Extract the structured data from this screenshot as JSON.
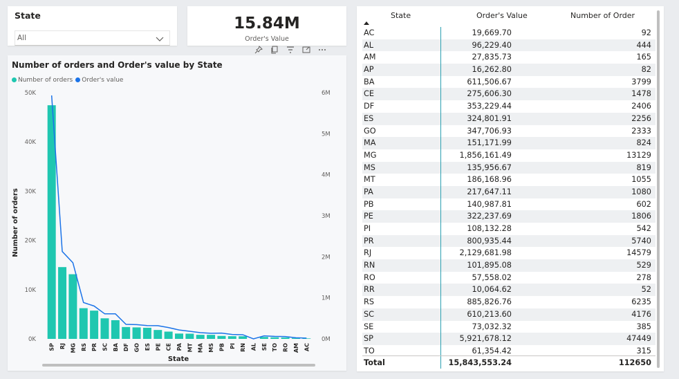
{
  "slicer": {
    "title": "State",
    "selected": "All"
  },
  "kpi": {
    "value": "15.84M",
    "label": "Order's Value"
  },
  "chart_title": "Number of orders and Order's value by State",
  "chart_data": {
    "type": "bar",
    "title": "Number of orders and Order's value by State",
    "xlabel": "State",
    "ylabel": "Number of orders",
    "categories": [
      "SP",
      "RJ",
      "MG",
      "RS",
      "PR",
      "SC",
      "BA",
      "DF",
      "GO",
      "ES",
      "PE",
      "CE",
      "PA",
      "MT",
      "MA",
      "MS",
      "PB",
      "PI",
      "RN",
      "AL",
      "SE",
      "TO",
      "RO",
      "AM",
      "AC"
    ],
    "series": [
      {
        "name": "Number of orders",
        "axis": "left",
        "mark": "bar",
        "color": "#1fc7b0",
        "values": [
          47449,
          14579,
          13129,
          6235,
          5740,
          4176,
          3799,
          2406,
          2333,
          2256,
          1806,
          1478,
          1080,
          1055,
          824,
          819,
          602,
          542,
          529,
          0,
          385,
          315,
          278,
          165,
          92
        ]
      },
      {
        "name": "Order's value",
        "axis": "right",
        "mark": "line",
        "color": "#1a73e8",
        "values": [
          5921678.12,
          2129681.98,
          1856161.49,
          885826.76,
          800935.44,
          610213.6,
          611506.67,
          353229.44,
          347706.93,
          324801.91,
          322237.69,
          275606.3,
          217647.11,
          186168.96,
          151171.99,
          135956.67,
          140987.81,
          108132.28,
          101895.08,
          0,
          73032.32,
          61354.42,
          57558.02,
          27835.73,
          19669.7
        ]
      }
    ],
    "ylim": [
      0,
      50000
    ],
    "ylim_right": [
      0,
      6000000
    ],
    "yticks_left": [
      "0K",
      "10K",
      "20K",
      "30K",
      "40K",
      "50K"
    ],
    "yticks_right": [
      "0M",
      "1M",
      "2M",
      "3M",
      "4M",
      "5M",
      "6M"
    ],
    "legend": "top-left",
    "grid": false
  },
  "legend": {
    "items": [
      "Number of orders",
      "Order's value"
    ]
  },
  "table": {
    "headers": [
      "State",
      "Order's Value",
      "Number of Order"
    ],
    "rows": [
      [
        "AC",
        "19,669.70",
        "92"
      ],
      [
        "AL",
        "96,229.40",
        "444"
      ],
      [
        "AM",
        "27,835.73",
        "165"
      ],
      [
        "AP",
        "16,262.80",
        "82"
      ],
      [
        "BA",
        "611,506.67",
        "3799"
      ],
      [
        "CE",
        "275,606.30",
        "1478"
      ],
      [
        "DF",
        "353,229.44",
        "2406"
      ],
      [
        "ES",
        "324,801.91",
        "2256"
      ],
      [
        "GO",
        "347,706.93",
        "2333"
      ],
      [
        "MA",
        "151,171.99",
        "824"
      ],
      [
        "MG",
        "1,856,161.49",
        "13129"
      ],
      [
        "MS",
        "135,956.67",
        "819"
      ],
      [
        "MT",
        "186,168.96",
        "1055"
      ],
      [
        "PA",
        "217,647.11",
        "1080"
      ],
      [
        "PB",
        "140,987.81",
        "602"
      ],
      [
        "PE",
        "322,237.69",
        "1806"
      ],
      [
        "PI",
        "108,132.28",
        "542"
      ],
      [
        "PR",
        "800,935.44",
        "5740"
      ],
      [
        "RJ",
        "2,129,681.98",
        "14579"
      ],
      [
        "RN",
        "101,895.08",
        "529"
      ],
      [
        "RO",
        "57,558.02",
        "278"
      ],
      [
        "RR",
        "10,064.62",
        "52"
      ],
      [
        "RS",
        "885,826.76",
        "6235"
      ],
      [
        "SC",
        "610,213.60",
        "4176"
      ],
      [
        "SE",
        "73,032.32",
        "385"
      ],
      [
        "SP",
        "5,921,678.12",
        "47449"
      ],
      [
        "TO",
        "61,354.42",
        "315"
      ]
    ],
    "total": [
      "Total",
      "15,843,553.24",
      "112650"
    ]
  },
  "colors": {
    "bar": "#1fc7b0",
    "line": "#1a73e8",
    "divider": "#2a9fb0"
  }
}
